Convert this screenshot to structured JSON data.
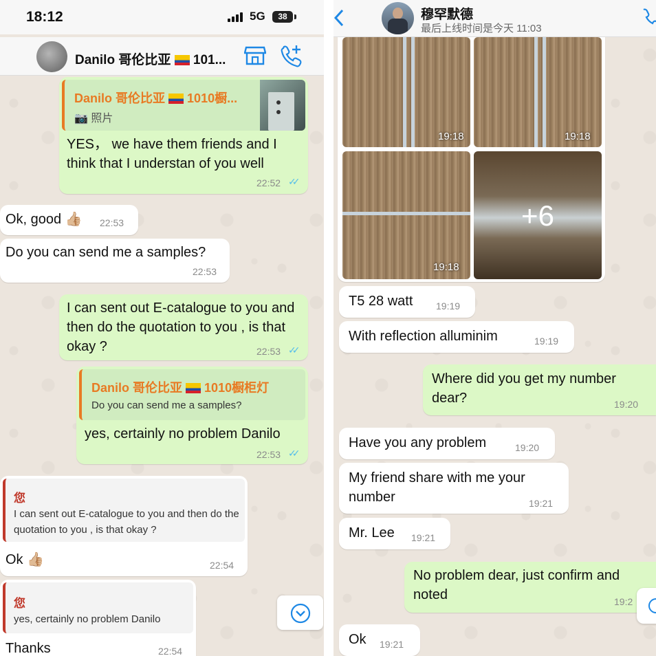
{
  "left": {
    "status_bar": {
      "time": "18:12",
      "network": "5G",
      "battery": "38"
    },
    "header": {
      "name": "Danilo 哥伦比亚",
      "name_suffix": "101..."
    },
    "messages": {
      "m1": {
        "quote_name": "Danilo 哥伦比亚",
        "quote_name_suffix": "1010橱...",
        "quote_text": "照片",
        "text": "YES， we have them friends and I think that I understan of you well",
        "time": "22:52"
      },
      "m2": {
        "text": "Ok, good",
        "emoji": "👍🏼",
        "time": "22:53"
      },
      "m3": {
        "text": "Do you can send me a samples?",
        "time": "22:53"
      },
      "m4": {
        "text": "I can sent out E-catalogue to you and then do the quotation to you , is that okay ?",
        "time": "22:53"
      },
      "m5": {
        "quote_name": "Danilo 哥伦比亚",
        "quote_name_suffix": "1010橱柜灯",
        "quote_text": "Do you can send me a samples?",
        "text": "yes, certainly no problem Danilo",
        "time": "22:53"
      },
      "m6": {
        "quote_name": "您",
        "quote_text": "I can sent out E-catalogue to you and then do the quotation to you , is that okay ?",
        "text": "Ok",
        "emoji": "👍🏼",
        "time": "22:54"
      },
      "m7": {
        "quote_name": "您",
        "quote_text": "yes, certainly no problem Danilo",
        "text": "Thanks",
        "time": "22:54"
      }
    }
  },
  "right": {
    "header": {
      "name": "穆罕默德",
      "status": "最后上线时间是今天 11:03"
    },
    "photos": {
      "t1": "19:18",
      "t2": "19:18",
      "t3": "19:18",
      "more": "+6"
    },
    "messages": {
      "r1": {
        "text": "T5 28 watt",
        "time": "19:19"
      },
      "r2": {
        "text": "With reflection alluminim",
        "time": "19:19"
      },
      "r3": {
        "text": "Where did you get my number dear?",
        "time": "19:20"
      },
      "r4": {
        "text": "Have you any problem",
        "time": "19:20"
      },
      "r5": {
        "text": "My friend share with me your number",
        "time": "19:21"
      },
      "r6": {
        "text": "Mr. Lee",
        "time": "19:21"
      },
      "r7": {
        "text": "No problem dear, just confirm and noted",
        "time": "19:2"
      },
      "r8": {
        "text": "Ok",
        "time": "19:21"
      }
    }
  },
  "colors": {
    "accent": "#1e88e5",
    "out_bubble": "#dcf8c6",
    "in_bubble": "#ffffff",
    "quote_orange": "#e87a23",
    "quote_red": "#c0392b",
    "read_ticks": "#53bdeb"
  },
  "icons": [
    "signal-icon",
    "battery-icon",
    "store-icon",
    "add-call-icon",
    "camera-icon",
    "back-chevron-icon",
    "call-icon",
    "scroll-down-icon",
    "double-check-icon"
  ]
}
